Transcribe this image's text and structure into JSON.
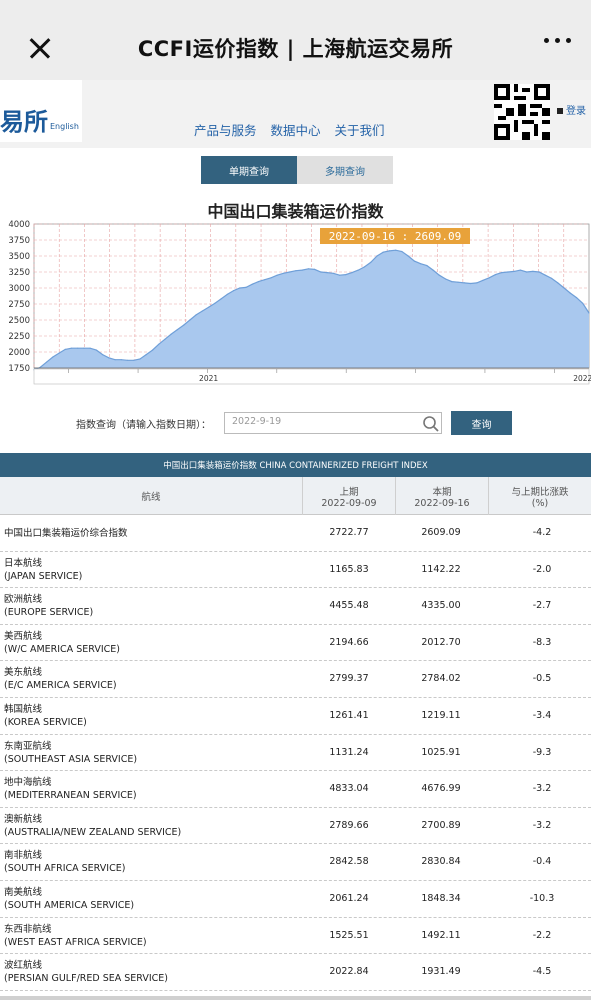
{
  "window": {
    "title": "CCFI运价指数 | 上海航运交易所"
  },
  "header": {
    "logo_text": "易所",
    "logo_en": "English",
    "nav": [
      "产品与服务",
      "数据中心",
      "关于我们"
    ],
    "login": "登录"
  },
  "tabs": {
    "single": "单期查询",
    "multi": "多期查询"
  },
  "chart_title": "中国出口集装箱运价指数",
  "chart_data": {
    "type": "area",
    "title": "中国出口集装箱运价指数",
    "tooltip": "2022-09-16 : 2609.09",
    "ylim": [
      1750,
      4000
    ],
    "yticks": [
      1750,
      2000,
      2250,
      2500,
      2750,
      3000,
      3250,
      3500,
      3750,
      4000
    ],
    "xticks": [
      "2021",
      "2022"
    ],
    "xtick_index": [
      28,
      88
    ],
    "grid": true,
    "fill_color": "#a9c8ee",
    "line_color": "#6f9fd8",
    "values": [
      1720,
      1760,
      1840,
      1920,
      1980,
      2040,
      2060,
      2060,
      2060,
      2060,
      2030,
      1960,
      1910,
      1880,
      1880,
      1870,
      1870,
      1890,
      1960,
      2030,
      2120,
      2200,
      2280,
      2350,
      2420,
      2500,
      2580,
      2640,
      2700,
      2760,
      2830,
      2900,
      2960,
      3000,
      3010,
      3060,
      3100,
      3130,
      3160,
      3200,
      3230,
      3250,
      3270,
      3280,
      3300,
      3290,
      3250,
      3240,
      3230,
      3200,
      3210,
      3240,
      3280,
      3330,
      3400,
      3500,
      3560,
      3580,
      3590,
      3570,
      3500,
      3420,
      3380,
      3350,
      3280,
      3200,
      3140,
      3100,
      3090,
      3080,
      3070,
      3080,
      3120,
      3160,
      3210,
      3240,
      3250,
      3260,
      3280,
      3250,
      3260,
      3250,
      3200,
      3150,
      3080,
      3000,
      2920,
      2850,
      2760,
      2609
    ]
  },
  "query": {
    "label": "指数查询（请输入指数日期）：",
    "placeholder": "2022-9-19",
    "button": "查询"
  },
  "table": {
    "banner": "中国出口集装箱运价指数 CHINA CONTAINERIZED FREIGHT INDEX",
    "headers": {
      "route": "航线",
      "prev_label": "上期",
      "prev_date": "2022-09-09",
      "curr_label": "本期",
      "curr_date": "2022-09-16",
      "change_label": "与上期比涨跌",
      "change_unit": "(%)"
    },
    "rows": [
      {
        "cn": "中国出口集装箱运价综合指数",
        "en": "",
        "prev": "2722.77",
        "curr": "2609.09",
        "change": "-4.2"
      },
      {
        "cn": "日本航线",
        "en": "(JAPAN SERVICE)",
        "prev": "1165.83",
        "curr": "1142.22",
        "change": "-2.0"
      },
      {
        "cn": "欧洲航线",
        "en": "(EUROPE SERVICE)",
        "prev": "4455.48",
        "curr": "4335.00",
        "change": "-2.7"
      },
      {
        "cn": "美西航线",
        "en": "(W/C AMERICA SERVICE)",
        "prev": "2194.66",
        "curr": "2012.70",
        "change": "-8.3"
      },
      {
        "cn": "美东航线",
        "en": "(E/C AMERICA SERVICE)",
        "prev": "2799.37",
        "curr": "2784.02",
        "change": "-0.5"
      },
      {
        "cn": "韩国航线",
        "en": "(KOREA SERVICE)",
        "prev": "1261.41",
        "curr": "1219.11",
        "change": "-3.4"
      },
      {
        "cn": "东南亚航线",
        "en": "(SOUTHEAST ASIA SERVICE)",
        "prev": "1131.24",
        "curr": "1025.91",
        "change": "-9.3"
      },
      {
        "cn": "地中海航线",
        "en": "(MEDITERRANEAN SERVICE)",
        "prev": "4833.04",
        "curr": "4676.99",
        "change": "-3.2"
      },
      {
        "cn": "澳新航线",
        "en": "(AUSTRALIA/NEW ZEALAND SERVICE)",
        "prev": "2789.66",
        "curr": "2700.89",
        "change": "-3.2"
      },
      {
        "cn": "南非航线",
        "en": "(SOUTH AFRICA SERVICE)",
        "prev": "2842.58",
        "curr": "2830.84",
        "change": "-0.4"
      },
      {
        "cn": "南美航线",
        "en": "(SOUTH AMERICA SERVICE)",
        "prev": "2061.24",
        "curr": "1848.34",
        "change": "-10.3"
      },
      {
        "cn": "东西非航线",
        "en": "(WEST EAST AFRICA SERVICE)",
        "prev": "1525.51",
        "curr": "1492.11",
        "change": "-2.2"
      },
      {
        "cn": "波红航线",
        "en": "(PERSIAN GULF/RED SEA SERVICE)",
        "prev": "2022.84",
        "curr": "1931.49",
        "change": "-4.5"
      }
    ]
  }
}
